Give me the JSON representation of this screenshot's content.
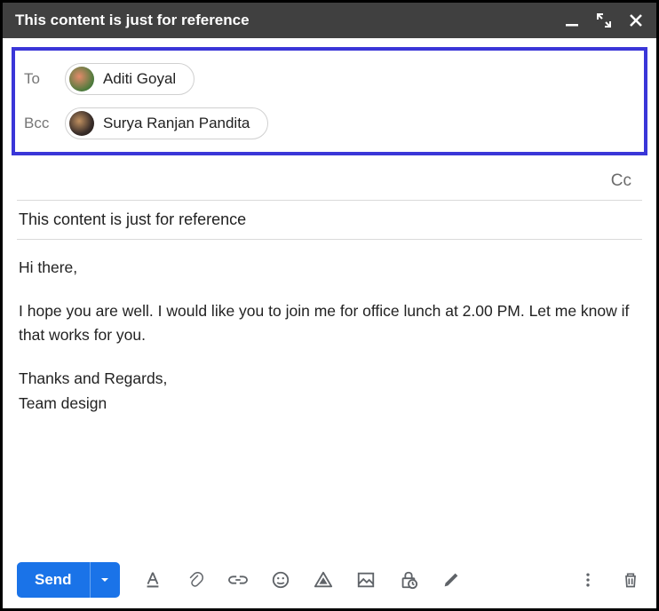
{
  "titlebar": {
    "title": "This content is just for reference"
  },
  "recipients": {
    "to_label": "To",
    "to_name": "Aditi Goyal",
    "bcc_label": "Bcc",
    "bcc_name": "Surya Ranjan Pandita",
    "cc_toggle": "Cc"
  },
  "subject": "This content is just for reference",
  "body": {
    "greeting": "Hi there,",
    "para1": "I hope you are well. I would like you to join me for office lunch at 2.00 PM. Let me know if that works for you.",
    "signoff": "Thanks and Regards,\nTeam design"
  },
  "toolbar": {
    "send_label": "Send"
  }
}
